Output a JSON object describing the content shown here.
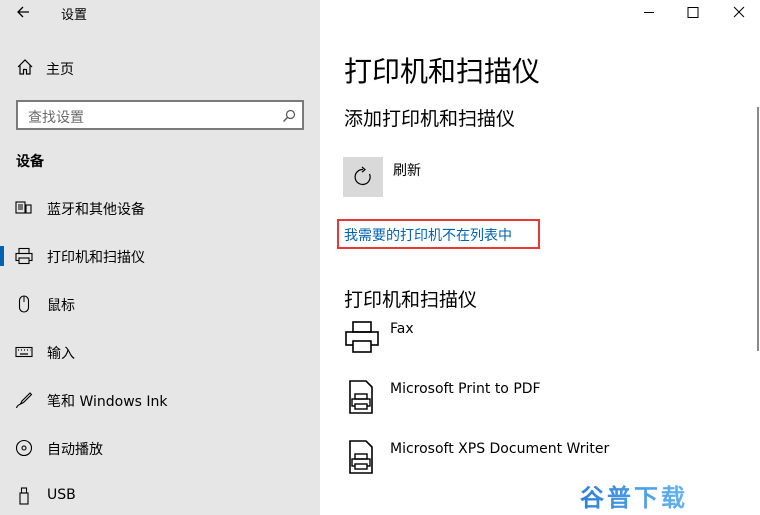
{
  "window": {
    "title": "设置"
  },
  "sidebar": {
    "home_label": "主页",
    "search_placeholder": "查找设置",
    "section_title": "设备",
    "items": [
      {
        "label": "蓝牙和其他设备",
        "icon": "bluetooth-devices-icon",
        "selected": false
      },
      {
        "label": "打印机和扫描仪",
        "icon": "printer-icon",
        "selected": true
      },
      {
        "label": "鼠标",
        "icon": "mouse-icon",
        "selected": false
      },
      {
        "label": "输入",
        "icon": "keyboard-icon",
        "selected": false
      },
      {
        "label": "笔和 Windows Ink",
        "icon": "pen-icon",
        "selected": false
      },
      {
        "label": "自动播放",
        "icon": "autoplay-icon",
        "selected": false
      },
      {
        "label": "USB",
        "icon": "usb-icon",
        "selected": false
      }
    ]
  },
  "main": {
    "page_title": "打印机和扫描仪",
    "add_section_title": "添加打印机和扫描仪",
    "refresh_label": "刷新",
    "not_listed_link": "我需要的打印机不在列表中",
    "printers_section_title": "打印机和扫描仪",
    "printers": [
      {
        "name": "Fax",
        "icon": "fax-printer-icon"
      },
      {
        "name": "Microsoft Print to PDF",
        "icon": "document-printer-icon"
      },
      {
        "name": "Microsoft XPS Document Writer",
        "icon": "document-printer-icon"
      }
    ]
  },
  "watermark": {
    "text": "谷普下载"
  },
  "colors": {
    "accent": "#0063b1",
    "highlight_box": "#e53935",
    "sidebar_bg": "#e6e6e6"
  }
}
